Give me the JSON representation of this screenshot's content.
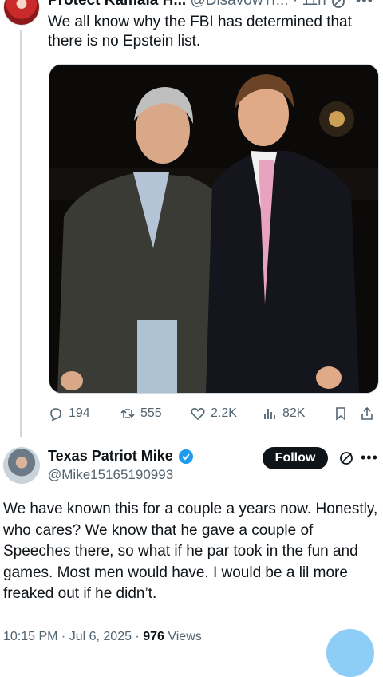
{
  "parent_tweet": {
    "display_name": "Protect Kamala H...",
    "handle": "@DisavowTr...",
    "separator": "·",
    "time": "11h",
    "text": "We all know why the FBI has determined that there is no Epstein list.",
    "metrics": {
      "replies": "194",
      "reposts": "555",
      "likes": "2.2K",
      "views": "82K"
    }
  },
  "reply_tweet": {
    "display_name": "Texas Patriot Mike",
    "handle": "@Mike15165190993",
    "follow_label": "Follow",
    "text": "We have known this for a couple a years now. Honestly, who cares? We know that he gave a couple of Speeches there, so what if he par took in the fun and games.  Most men would have.  I would be a lil more freaked out if he didn’t.",
    "timestamp": "10:15 PM · Jul 6, 2025 · ",
    "views_count": "976",
    "views_label": " Views"
  },
  "icons": {
    "more": "more-icon",
    "grok": "grok-icon",
    "reply": "reply-icon",
    "repost": "repost-icon",
    "like": "heart-icon",
    "views": "views-icon",
    "bookmark": "bookmark-icon",
    "share": "share-icon",
    "verified": "verified-badge-icon"
  },
  "colors": {
    "verified": "#1d9bf0",
    "follow_bg": "#0f1419",
    "secondary_text": "#536471"
  }
}
